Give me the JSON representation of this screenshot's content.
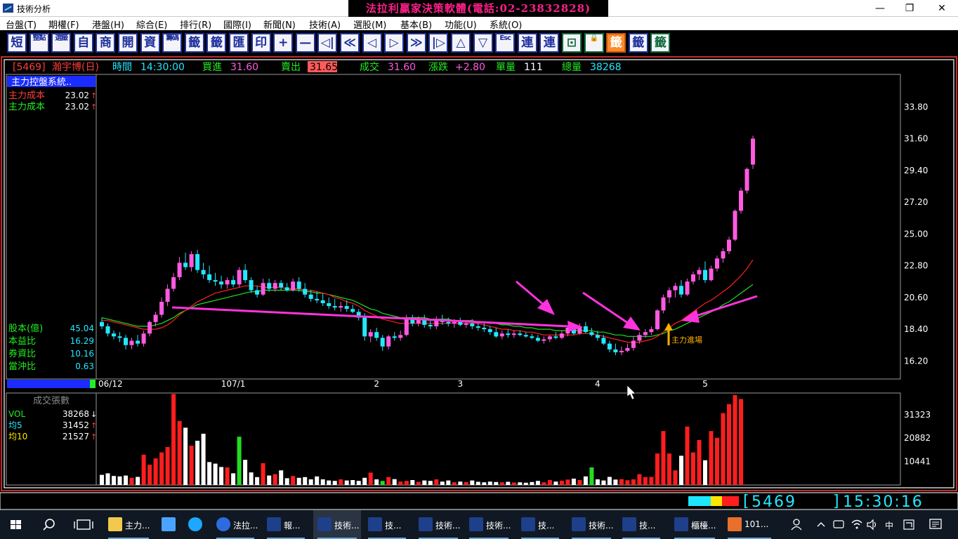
{
  "window": {
    "title": "技術分析",
    "banner": "法拉利贏家決策軟體(電話:02-23832828)",
    "controls": [
      "—",
      "❐",
      "✕"
    ]
  },
  "menu": [
    "台盤(T)",
    "期權(F)",
    "港盤(H)",
    "綜合(E)",
    "排行(R)",
    "國際(I)",
    "新聞(N)",
    "技術(A)",
    "選股(M)",
    "基本(B)",
    "功能(U)",
    "系統(O)"
  ],
  "toolbar": [
    "短",
    "整點",
    "選籤",
    "自",
    "商",
    "開",
    "資",
    "籌碼",
    "籤",
    "籤",
    "匯",
    "印",
    "+",
    "—",
    "◁|",
    "≪",
    "◁",
    "▷",
    "≫",
    "|▷",
    "△",
    "▽",
    "Esc",
    "連",
    "連",
    "⊡",
    "🔒",
    "籤",
    "籤",
    "籤"
  ],
  "quote": {
    "symbol": "[5469]",
    "name": "瀚宇博(日)",
    "time_label": "時間",
    "time": "14:30:00",
    "bid_label": "買進",
    "bid": "31.60",
    "ask_label": "賣出",
    "ask": "31.65",
    "last_label": "成交",
    "last": "31.60",
    "change_label": "漲跌",
    "change": "+2.80",
    "single_vol_label": "單量",
    "single_vol": "111",
    "total_vol_label": "總量",
    "total_vol": "38268"
  },
  "panel": {
    "indicator": "主力控盤系統..",
    "cost_rows": [
      {
        "label": "主力成本",
        "value": "23.02",
        "arrow": "↑"
      },
      {
        "label": "主力成本",
        "value": "23.02",
        "arrow": "↑"
      }
    ],
    "fundamentals": [
      {
        "label": "股本(億)",
        "value": "45.04"
      },
      {
        "label": "本益比",
        "value": "16.29"
      },
      {
        "label": "券資比",
        "value": "10.16"
      },
      {
        "label": "當沖比",
        "value": "0.63"
      }
    ],
    "volume_title": "成交張數",
    "volume_rows": [
      {
        "label": "VOL",
        "value": "38268",
        "arrow": "↓"
      },
      {
        "label": "均5",
        "value": "31452",
        "arrow": "↑"
      },
      {
        "label": "均10",
        "value": "21527",
        "arrow": "↑"
      }
    ]
  },
  "chart_data": [
    {
      "type": "candlestick",
      "y_ticks": [
        "33.80",
        "31.60",
        "29.40",
        "27.20",
        "25.00",
        "22.80",
        "20.60",
        "18.40",
        "16.20"
      ],
      "ylim": [
        15.0,
        36.0
      ],
      "x_labels": [
        "06/12",
        "107/1",
        "2",
        "3",
        "4",
        "5"
      ],
      "annotation": "主力進場",
      "colors": {
        "up": "#ff5ae0",
        "down": "#22e8ff",
        "ma_short": "#ff2020",
        "ma_long": "#20e020",
        "arrow": "#ff33dd"
      },
      "candles": [
        [
          18.9,
          19.2,
          18.4,
          18.6
        ],
        [
          18.6,
          18.8,
          17.9,
          18.1
        ],
        [
          18.1,
          18.3,
          17.7,
          17.9
        ],
        [
          17.9,
          18.2,
          17.5,
          17.8
        ],
        [
          17.8,
          18.0,
          17.0,
          17.3
        ],
        [
          17.3,
          17.8,
          17.0,
          17.6
        ],
        [
          17.6,
          18.0,
          17.2,
          17.4
        ],
        [
          17.4,
          18.3,
          17.2,
          18.1
        ],
        [
          18.1,
          19.0,
          17.9,
          18.9
        ],
        [
          18.9,
          19.6,
          18.6,
          19.4
        ],
        [
          19.4,
          20.6,
          19.2,
          20.3
        ],
        [
          20.3,
          21.5,
          20.0,
          21.2
        ],
        [
          21.2,
          22.3,
          21.0,
          22.0
        ],
        [
          22.0,
          23.4,
          21.8,
          23.0
        ],
        [
          23.0,
          23.7,
          22.5,
          22.7
        ],
        [
          22.7,
          23.8,
          22.4,
          23.6
        ],
        [
          23.6,
          23.9,
          22.3,
          22.5
        ],
        [
          22.5,
          23.0,
          21.9,
          22.2
        ],
        [
          22.2,
          22.8,
          21.6,
          21.8
        ],
        [
          21.8,
          22.3,
          21.4,
          21.7
        ],
        [
          21.7,
          22.1,
          21.2,
          21.5
        ],
        [
          21.5,
          22.0,
          21.2,
          21.8
        ],
        [
          21.8,
          22.1,
          21.3,
          21.5
        ],
        [
          21.5,
          22.7,
          21.3,
          22.5
        ],
        [
          22.5,
          22.9,
          21.6,
          21.8
        ],
        [
          21.8,
          22.0,
          20.9,
          21.1
        ],
        [
          21.1,
          21.4,
          20.6,
          20.8
        ],
        [
          20.8,
          21.9,
          20.7,
          21.6
        ],
        [
          21.6,
          21.9,
          21.0,
          21.2
        ],
        [
          21.2,
          21.8,
          21.0,
          21.6
        ],
        [
          21.6,
          21.8,
          21.1,
          21.3
        ],
        [
          21.3,
          21.6,
          21.0,
          21.1
        ],
        [
          21.1,
          21.9,
          21.0,
          21.7
        ],
        [
          21.7,
          22.0,
          21.0,
          21.2
        ],
        [
          21.2,
          21.6,
          20.6,
          20.8
        ],
        [
          20.8,
          21.1,
          20.3,
          20.5
        ],
        [
          20.5,
          21.0,
          20.2,
          20.4
        ],
        [
          20.4,
          20.9,
          20.0,
          20.2
        ],
        [
          20.2,
          20.6,
          19.8,
          20.0
        ],
        [
          20.0,
          20.5,
          19.7,
          19.9
        ],
        [
          19.9,
          20.3,
          19.6,
          20.0
        ],
        [
          20.0,
          20.4,
          19.6,
          19.8
        ],
        [
          19.8,
          20.1,
          19.5,
          19.6
        ],
        [
          19.6,
          19.8,
          19.0,
          19.2
        ],
        [
          19.2,
          19.5,
          17.6,
          17.9
        ],
        [
          17.9,
          18.4,
          17.5,
          18.2
        ],
        [
          18.2,
          18.5,
          17.6,
          17.8
        ],
        [
          17.8,
          18.0,
          16.9,
          17.2
        ],
        [
          17.2,
          18.0,
          17.0,
          17.9
        ],
        [
          17.9,
          18.2,
          17.6,
          17.8
        ],
        [
          17.8,
          18.3,
          17.6,
          18.0
        ],
        [
          18.0,
          19.4,
          17.9,
          19.2
        ],
        [
          19.2,
          19.4,
          18.6,
          18.8
        ],
        [
          18.8,
          19.3,
          18.6,
          19.1
        ],
        [
          19.1,
          19.4,
          18.5,
          18.7
        ],
        [
          18.7,
          19.0,
          18.4,
          18.6
        ],
        [
          18.6,
          19.3,
          18.4,
          19.1
        ],
        [
          19.1,
          19.4,
          18.7,
          18.9
        ],
        [
          18.9,
          19.2,
          18.6,
          18.8
        ],
        [
          18.8,
          19.1,
          18.5,
          18.9
        ],
        [
          18.9,
          19.2,
          18.6,
          18.7
        ],
        [
          18.7,
          19.0,
          18.5,
          18.8
        ],
        [
          18.8,
          19.1,
          18.4,
          18.6
        ],
        [
          18.6,
          18.9,
          18.3,
          18.5
        ],
        [
          18.5,
          18.8,
          18.2,
          18.4
        ],
        [
          18.4,
          18.6,
          18.0,
          18.2
        ],
        [
          18.2,
          18.5,
          17.8,
          17.9
        ],
        [
          17.9,
          18.3,
          17.7,
          18.1
        ],
        [
          18.1,
          18.4,
          17.8,
          18.0
        ],
        [
          18.0,
          18.3,
          17.8,
          18.1
        ],
        [
          18.1,
          18.3,
          17.9,
          18.0
        ],
        [
          18.0,
          18.2,
          17.8,
          17.9
        ],
        [
          17.9,
          18.1,
          17.7,
          17.8
        ],
        [
          17.8,
          18.0,
          17.5,
          17.6
        ],
        [
          17.6,
          17.9,
          17.4,
          17.7
        ],
        [
          17.7,
          18.0,
          17.5,
          17.9
        ],
        [
          17.9,
          18.2,
          17.7,
          17.8
        ],
        [
          17.8,
          18.3,
          17.7,
          18.1
        ],
        [
          18.1,
          18.6,
          17.9,
          18.5
        ],
        [
          18.5,
          18.7,
          18.0,
          18.1
        ],
        [
          18.1,
          18.8,
          18.0,
          18.6
        ],
        [
          18.6,
          18.9,
          18.1,
          18.2
        ],
        [
          18.2,
          18.5,
          17.9,
          18.0
        ],
        [
          18.0,
          18.3,
          17.6,
          17.8
        ],
        [
          17.8,
          18.0,
          17.3,
          17.4
        ],
        [
          17.4,
          17.6,
          16.8,
          17.0
        ],
        [
          17.0,
          17.4,
          16.6,
          16.8
        ],
        [
          16.8,
          17.2,
          16.6,
          16.9
        ],
        [
          16.9,
          17.4,
          16.8,
          17.1
        ],
        [
          17.1,
          17.9,
          16.9,
          17.6
        ],
        [
          17.6,
          18.2,
          17.4,
          18.0
        ],
        [
          18.0,
          18.4,
          17.8,
          18.2
        ],
        [
          18.2,
          18.6,
          18.0,
          18.4
        ],
        [
          18.4,
          19.8,
          18.3,
          19.7
        ],
        [
          19.7,
          20.8,
          19.5,
          20.6
        ],
        [
          20.6,
          21.3,
          20.2,
          21.1
        ],
        [
          21.1,
          21.6,
          20.6,
          21.4
        ],
        [
          21.4,
          21.8,
          20.6,
          20.8
        ],
        [
          20.8,
          21.9,
          20.7,
          21.7
        ],
        [
          21.7,
          22.4,
          21.5,
          22.2
        ],
        [
          22.2,
          22.7,
          21.8,
          22.5
        ],
        [
          22.5,
          23.1,
          21.6,
          21.8
        ],
        [
          21.8,
          22.8,
          21.7,
          22.6
        ],
        [
          22.6,
          23.5,
          22.4,
          23.3
        ],
        [
          23.3,
          24.0,
          23.0,
          23.8
        ],
        [
          23.8,
          24.8,
          23.6,
          24.6
        ],
        [
          24.6,
          26.7,
          24.5,
          26.6
        ],
        [
          26.6,
          28.2,
          26.4,
          28.0
        ],
        [
          28.0,
          29.6,
          27.8,
          29.5
        ],
        [
          29.8,
          31.8,
          29.5,
          31.6
        ]
      ],
      "ma_short": [
        19.0,
        19.0,
        18.9,
        18.8,
        18.7,
        18.6,
        18.5,
        18.4,
        18.4,
        18.4,
        18.5,
        18.7,
        19.0,
        19.4,
        19.7,
        20.0,
        20.3,
        20.5,
        20.7,
        20.9,
        21.0,
        21.1,
        21.2,
        21.3,
        21.4,
        21.4,
        21.4,
        21.3,
        21.3,
        21.3,
        21.3,
        21.2,
        21.2,
        21.2,
        21.1,
        21.1,
        21.0,
        20.9,
        20.8,
        20.6,
        20.5,
        20.3,
        20.2,
        20.0,
        19.7,
        19.5,
        19.3,
        19.1,
        19.0,
        18.9,
        18.8,
        18.8,
        18.8,
        18.8,
        18.8,
        18.8,
        18.8,
        18.8,
        18.8,
        18.8,
        18.8,
        18.8,
        18.8,
        18.8,
        18.7,
        18.6,
        18.5,
        18.4,
        18.4,
        18.3,
        18.3,
        18.2,
        18.2,
        18.1,
        18.0,
        18.0,
        18.0,
        18.0,
        18.0,
        18.0,
        18.1,
        18.1,
        18.1,
        18.0,
        17.9,
        17.8,
        17.7,
        17.6,
        17.5,
        17.5,
        17.5,
        17.6,
        17.7,
        17.9,
        18.2,
        18.5,
        18.8,
        19.0,
        19.3,
        19.6,
        19.9,
        20.2,
        20.4,
        20.7,
        21.0,
        21.3,
        21.7,
        22.1,
        22.6,
        23.2
      ],
      "ma_long": [
        19.2,
        19.1,
        19.0,
        18.9,
        18.8,
        18.7,
        18.6,
        18.6,
        18.6,
        18.7,
        18.8,
        19.0,
        19.2,
        19.5,
        19.7,
        19.9,
        20.1,
        20.2,
        20.3,
        20.4,
        20.5,
        20.6,
        20.7,
        20.8,
        20.9,
        21.0,
        21.0,
        21.1,
        21.1,
        21.1,
        21.1,
        21.1,
        21.1,
        21.1,
        21.0,
        21.0,
        20.9,
        20.9,
        20.8,
        20.7,
        20.6,
        20.5,
        20.4,
        20.2,
        20.0,
        19.8,
        19.7,
        19.5,
        19.4,
        19.3,
        19.2,
        19.2,
        19.2,
        19.2,
        19.2,
        19.1,
        19.1,
        19.1,
        19.1,
        19.0,
        19.0,
        19.0,
        19.0,
        18.9,
        18.9,
        18.8,
        18.8,
        18.7,
        18.7,
        18.6,
        18.6,
        18.5,
        18.5,
        18.4,
        18.4,
        18.4,
        18.3,
        18.3,
        18.3,
        18.3,
        18.3,
        18.3,
        18.3,
        18.2,
        18.2,
        18.1,
        18.0,
        18.0,
        17.9,
        17.9,
        17.9,
        17.9,
        17.9,
        18.0,
        18.1,
        18.3,
        18.4,
        18.6,
        18.8,
        19.0,
        19.2,
        19.4,
        19.6,
        19.8,
        20.1,
        20.3,
        20.6,
        20.9,
        21.2,
        21.5
      ]
    },
    {
      "type": "bar",
      "y_ticks": [
        "31323",
        "20882",
        "10441"
      ],
      "ylim": [
        0,
        40000
      ],
      "volumes": [
        4500,
        5200,
        4000,
        3800,
        4200,
        3200,
        3600,
        13500,
        9000,
        11800,
        14500,
        16900,
        40500,
        28500,
        25500,
        17500,
        19700,
        22800,
        10200,
        9500,
        8000,
        7800,
        5200,
        21500,
        11200,
        5600,
        3500,
        9700,
        4200,
        4800,
        6500,
        3000,
        4000,
        3200,
        3500,
        2500,
        3800,
        2500,
        2000,
        1800,
        2500,
        2000,
        2200,
        1800,
        3200,
        5500,
        2500,
        1800,
        3500,
        2600,
        1500,
        1800,
        2200,
        1400,
        2000,
        1800,
        2500,
        1500,
        2000,
        1200,
        1500,
        1300,
        2000,
        1400,
        1200,
        1500,
        1300,
        1200,
        1400,
        1100,
        1200,
        1000,
        1300,
        1800,
        1200,
        2200,
        1500,
        1900,
        2400,
        2800,
        2200,
        3800,
        7800,
        2500,
        2000,
        3600,
        2400,
        2600,
        2100,
        2500,
        4800,
        3500,
        3600,
        14000,
        24000,
        14000,
        6500,
        13000,
        26000,
        14500,
        20000,
        11000,
        24000,
        21000,
        32000,
        36000,
        40000,
        38268
      ],
      "colors": {
        "up": "#ff1e1e",
        "down": "#ffffff",
        "flat": "#22dd22"
      }
    }
  ],
  "status": {
    "symbol": "5469",
    "time": "15:30:16",
    "color_swatches": [
      "#1ee6ff",
      "#1ee6ff",
      "#ffe600",
      "#ff1e1e"
    ]
  },
  "taskbar": {
    "items": [
      {
        "icon": "folder-icon",
        "label": "主力..."
      },
      {
        "icon": "network-icon",
        "label": ""
      },
      {
        "icon": "ie-icon",
        "label": ""
      },
      {
        "icon": "app-icon",
        "label": "法拉..."
      },
      {
        "icon": "chart-app-icon",
        "label": "報..."
      },
      {
        "icon": "chart-app-icon",
        "label": "技術..."
      },
      {
        "icon": "chart-app-icon",
        "label": "技..."
      },
      {
        "icon": "chart-app-icon",
        "label": "技術..."
      },
      {
        "icon": "chart-app-icon",
        "label": "技術..."
      },
      {
        "icon": "chart-app-icon",
        "label": "技..."
      },
      {
        "icon": "chart-app-icon",
        "label": "技術..."
      },
      {
        "icon": "chart-app-icon",
        "label": "技..."
      },
      {
        "icon": "chart-app-icon",
        "label": "櫃檯..."
      },
      {
        "icon": "office-icon",
        "label": "101..."
      }
    ],
    "tray_lang": "中"
  }
}
